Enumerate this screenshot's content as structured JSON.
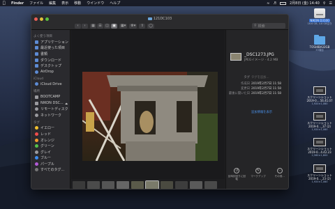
{
  "menubar": {
    "app": "Finder",
    "menus": [
      "ファイル",
      "編集",
      "表示",
      "移動",
      "ウインドウ",
      "ヘルプ"
    ],
    "status_time": "2月8日 (金) 14:40"
  },
  "window": {
    "title": "121DC103",
    "search_placeholder": "検索"
  },
  "sidebar": {
    "favorites_header": "よく使う項目",
    "favorites": [
      "アプリケーション",
      "最近使った項目",
      "書類",
      "ダウンロード",
      "デスクトップ",
      "AirDrop"
    ],
    "icloud_header": "iCloud",
    "icloud": [
      "iCloud Drive"
    ],
    "locations_header": "場所",
    "locations": [
      "BOOTCAMP",
      "NIKON DSC...",
      "リモートディスク",
      "ネットワーク"
    ],
    "tags_header": "タグ",
    "tags": [
      {
        "label": "イエロー",
        "color": "#f2c12e"
      },
      {
        "label": "レッド",
        "color": "#ee4d4d"
      },
      {
        "label": "オレンジ",
        "color": "#f39a2b"
      },
      {
        "label": "グリーン",
        "color": "#55c24a"
      },
      {
        "label": "グレイ",
        "color": "#9a9a9e"
      },
      {
        "label": "ブルー",
        "color": "#3c8cf0"
      },
      {
        "label": "パープル",
        "color": "#b25ad6"
      },
      {
        "label": "すべてのタグ...",
        "color": "#777777"
      }
    ]
  },
  "inspector": {
    "file_name": "_DSC1273.JPG",
    "file_kind": "JPEGイメージ - 4.2 MB",
    "rows": [
      {
        "key": "タグ",
        "value": "タグを追加..."
      },
      {
        "key": "作成日",
        "value": "2019年2月7日 11:58"
      },
      {
        "key": "変更日",
        "value": "2019年2月7日 11:58"
      },
      {
        "key": "最後に開いた日",
        "value": "2019年2月7日 11:58"
      }
    ],
    "more_link": "追加情報を表示",
    "actions": [
      {
        "icon": "rotate-left-icon",
        "label": "反時計回りに回転"
      },
      {
        "icon": "markup-icon",
        "label": "マークアップ"
      },
      {
        "icon": "more-icon",
        "label": "その他..."
      }
    ]
  },
  "desktop": {
    "drive": {
      "label": "NIKON D3100",
      "sub": "16.6 GB, 4.8 GB空き"
    },
    "folder": {
      "label": "TOSHIBA32GB",
      "sub": "33項目"
    },
    "screenshots": [
      {
        "label": "スクリーンショット",
        "label2": "2019-0....56.41.07",
        "sub": "1,920×1,080"
      },
      {
        "label": "スクリーンショット",
        "label2": "2019-0..._37 (2)",
        "sub": "1,920×1,080"
      },
      {
        "label": "スクリーンショット",
        "label2": "2019-0...4.42.23",
        "sub": "2,560×1,600"
      },
      {
        "label": "スクリーンショット",
        "label2": "2019-0..._23 (2)",
        "sub": "1,920×1,080"
      }
    ]
  }
}
